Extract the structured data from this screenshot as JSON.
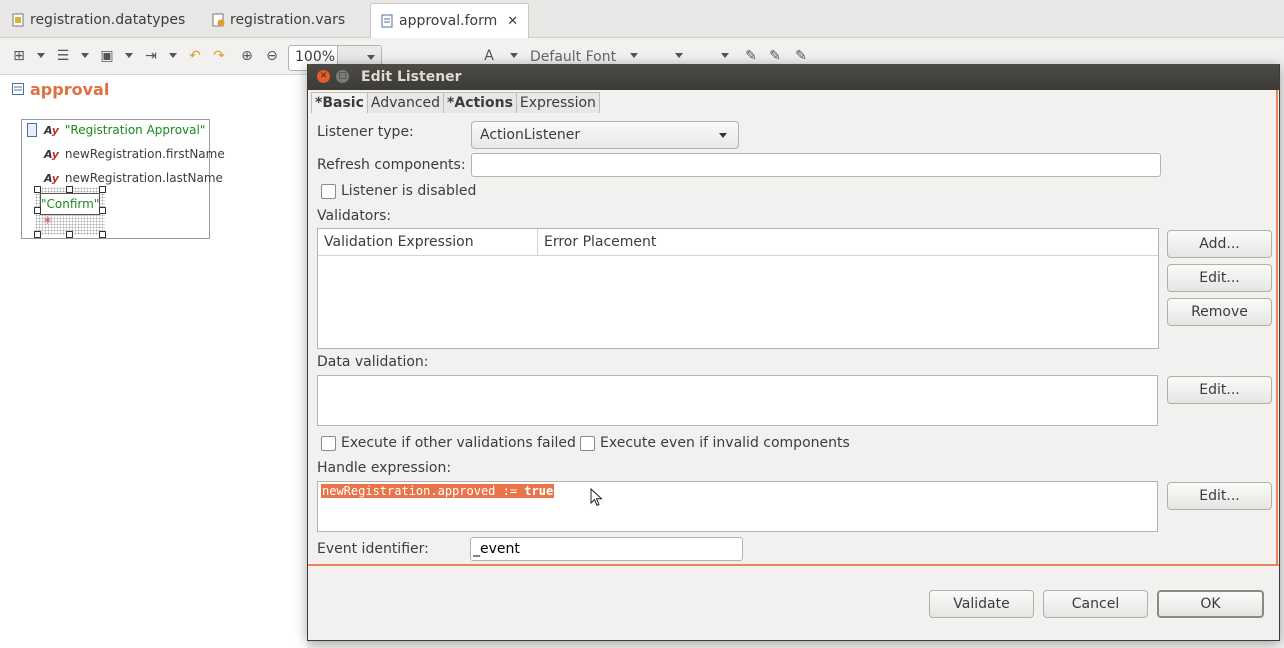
{
  "tabs": [
    {
      "label": "registration.datatypes",
      "icon": "datatypes-file-icon"
    },
    {
      "label": "registration.vars",
      "icon": "vars-file-icon"
    },
    {
      "label": "approval.form",
      "icon": "form-file-icon",
      "active": true
    }
  ],
  "toolbar": {
    "zoom_value": "100%",
    "font_label": "Default Font",
    "text_style": "A"
  },
  "form": {
    "title": "approval",
    "items": [
      {
        "text": "\"Registration Approval\"",
        "kind": "label-literal"
      },
      {
        "text": "newRegistration.firstName",
        "kind": "label-binding"
      },
      {
        "text": "newRegistration.lastName",
        "kind": "label-binding"
      }
    ],
    "button_text": "\"Confirm\"",
    "item_icon_text": "Ay"
  },
  "dialog": {
    "title": "Edit Listener",
    "tabs": [
      "*Basic",
      "Advanced",
      "*Actions",
      "Expression"
    ],
    "listener_type_label": "Listener type:",
    "listener_type_value": "ActionListener",
    "refresh_label": "Refresh components:",
    "refresh_value": "",
    "disabled_label": "Listener is disabled",
    "validators_label": "Validators:",
    "validators_columns": [
      "Validation Expression",
      "Error Placement"
    ],
    "add_button": "Add...",
    "edit_button": "Edit...",
    "remove_button": "Remove",
    "data_validation_label": "Data validation:",
    "exec_failed_label": "Execute if other validations failed",
    "exec_invalid_label": "Execute even if invalid components",
    "handle_label": "Handle expression:",
    "handle_code_prefix": "newRegistration.approved := ",
    "handle_code_keyword": "true",
    "event_id_label": "Event identifier:",
    "event_id_value": "_event",
    "validate_button": "Validate",
    "cancel_button": "Cancel",
    "ok_button": "OK"
  },
  "colors": {
    "accent": "#e07040",
    "selection": "#e8754a",
    "titlebar": "#3c3b37",
    "close_button": "#e45c2b"
  }
}
